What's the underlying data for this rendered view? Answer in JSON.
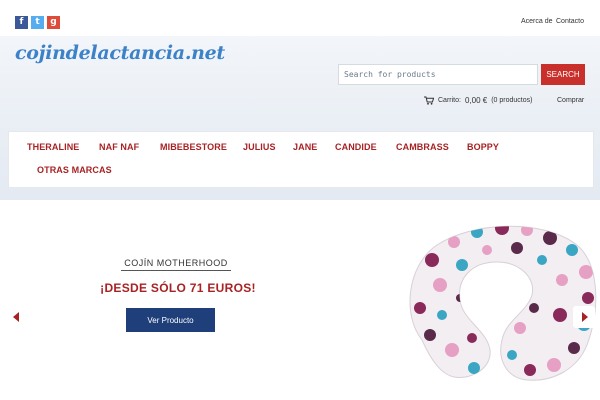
{
  "header": {
    "social": [
      {
        "icon": "facebook-icon",
        "glyph": "f"
      },
      {
        "icon": "twitter-icon",
        "glyph": "t"
      },
      {
        "icon": "google-plus-icon",
        "glyph": "g"
      }
    ],
    "links": {
      "about": "Acerca de",
      "contact": "Contacto"
    },
    "logo": "cojindelactancia.net"
  },
  "search": {
    "placeholder": "Search for products",
    "button": "SEARCH"
  },
  "cart": {
    "label": "Carrito:",
    "amount": "0,00 €",
    "count": "(0 productos)",
    "buy": "Comprar"
  },
  "nav": {
    "items": [
      "THERALINE",
      "NAF NAF",
      "MIBEBESTORE",
      "JULIUS",
      "JANE",
      "CANDIDE",
      "CAMBRASS",
      "BOPPY",
      "OTRAS MARCAS"
    ]
  },
  "hero": {
    "title": "COJÍN MOTHERHOOD",
    "subtitle": "¡DESDE SÓLO 71 EUROS!",
    "button": "Ver Producto"
  },
  "colors": {
    "accent": "#a82224",
    "brand_blue": "#3b82c8",
    "button_dark": "#1f3f7a",
    "search_button": "#c9302c"
  }
}
